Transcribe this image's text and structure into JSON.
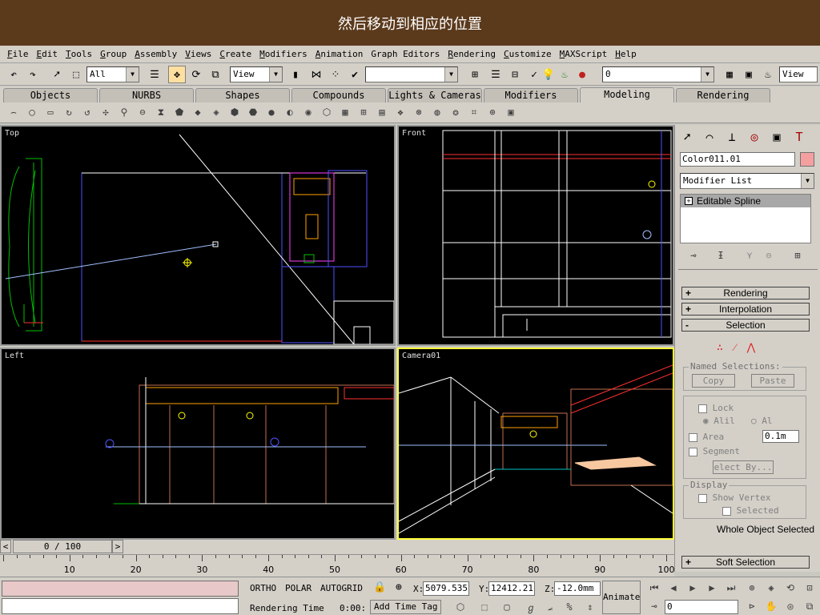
{
  "banner": {
    "title": "然后移动到相应的位置"
  },
  "menu": [
    {
      "u": "F",
      "rest": "ile"
    },
    {
      "u": "E",
      "rest": "dit"
    },
    {
      "u": "T",
      "rest": "ools"
    },
    {
      "u": "G",
      "rest": "roup"
    },
    {
      "u": "A",
      "rest": "ssembly"
    },
    {
      "u": "V",
      "rest": "iews"
    },
    {
      "u": "C",
      "rest": "reate"
    },
    {
      "u": "M",
      "rest": "odifiers"
    },
    {
      "u": "A",
      "rest": "nimation"
    },
    {
      "u": "",
      "rest": "Graph Editors"
    },
    {
      "u": "R",
      "rest": "endering"
    },
    {
      "u": "C",
      "rest": "ustomize"
    },
    {
      "u": "M",
      "rest": "AXScript"
    },
    {
      "u": "H",
      "rest": "elp"
    }
  ],
  "toolbar": {
    "filter": "All",
    "refcoord": "View",
    "named_sel": "",
    "layer": "0",
    "view_right": "View"
  },
  "tabs": [
    "Objects",
    "NURBS",
    "Shapes",
    "Compounds",
    "Lights & Cameras",
    "Modifiers",
    "Modeling",
    "Rendering"
  ],
  "active_tab": "Modeling",
  "viewports": {
    "top": "Top",
    "front": "Front",
    "left": "Left",
    "camera": "Camera01"
  },
  "panel": {
    "object_name": "Color011.01",
    "object_color": "#f4a0a0",
    "modifier_list": "Modifier List",
    "stack_item": "Editable Spline",
    "rollouts": {
      "rendering": "Rendering",
      "interpolation": "Interpolation",
      "selection": "Selection",
      "soft_selection": "Soft Selection"
    },
    "named_selections": {
      "title": "Named Selections:",
      "copy": "Copy",
      "paste": "Paste"
    },
    "lock": "Lock",
    "alil": "Alil",
    "al": "Al",
    "area": "Area",
    "area_value": "0.1m",
    "segment": "Segment",
    "select_by": "elect By...",
    "display": {
      "title": "Display",
      "show_vertex": "Show Vertex",
      "selected": "Selected"
    },
    "whole_object": "Whole Object Selected"
  },
  "timeline": {
    "frame": "0 / 100",
    "ticks": [
      "10",
      "20",
      "30",
      "40",
      "50",
      "60",
      "70",
      "80",
      "90",
      "100"
    ]
  },
  "status": {
    "ortho": "ORTHO",
    "polar": "POLAR",
    "autogrid": "AUTOGRID",
    "x_label": "X:",
    "x_val": "5079.535",
    "y_label": "Y:",
    "y_val": "12412.21",
    "z_label": "Z:",
    "z_val": "-12.0mm",
    "render_time": "Rendering Time",
    "time_val": "0:00:",
    "add_time_tag": "Add Time Tag",
    "animate": "Animate",
    "frame_field": "0"
  }
}
